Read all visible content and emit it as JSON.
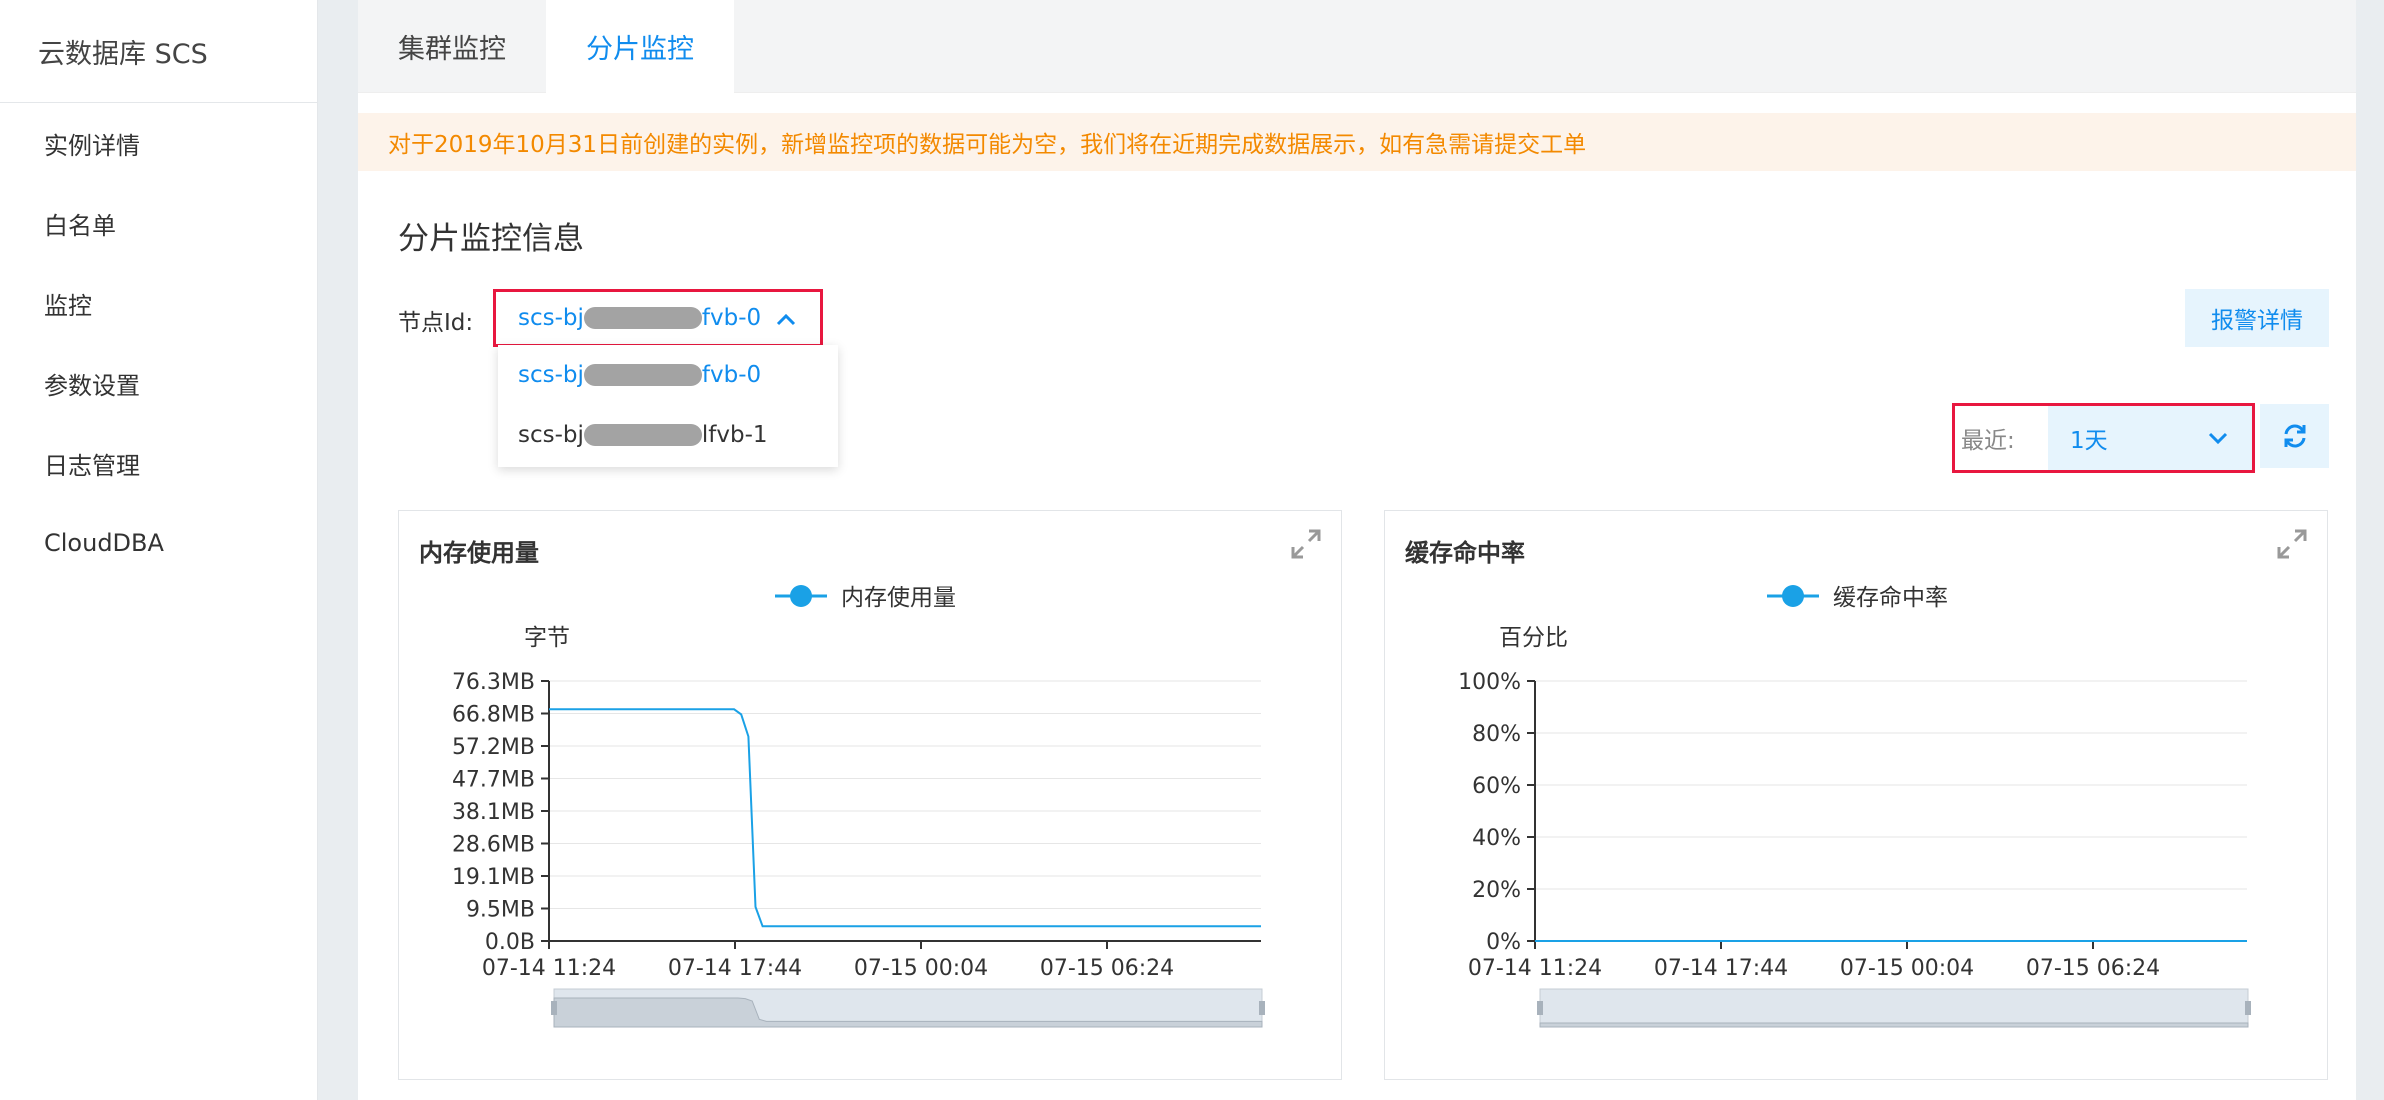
{
  "sidebar": {
    "product": "云数据库 SCS",
    "items": [
      "实例详情",
      "白名单",
      "监控",
      "参数设置",
      "日志管理",
      "CloudDBA"
    ]
  },
  "tabs": [
    {
      "label": "集群监控",
      "active": false
    },
    {
      "label": "分片监控",
      "active": true
    }
  ],
  "notice": "对于2019年10月31日前创建的实例，新增监控项的数据可能为空，我们将在近期完成数据展示，如有急需请提交工单",
  "section_title": "分片监控信息",
  "node": {
    "label": "节点Id:",
    "selected_prefix": "scs-bj",
    "selected_suffix": "fvb-0",
    "options": [
      {
        "prefix": "scs-bj",
        "suffix": "fvb-0",
        "selected": true
      },
      {
        "prefix": "scs-bj",
        "suffix": "lfvb-1",
        "selected": false
      }
    ]
  },
  "alarm_button": "报警详情",
  "recent": {
    "label": "最近:",
    "value": "1天"
  },
  "icons": {
    "refresh": "refresh-icon",
    "expand": "expand-icon",
    "chevron_up": "chevron-up-icon",
    "chevron_down": "chevron-down-icon"
  },
  "colors": {
    "accent": "#108cee",
    "series": "#1aa1e6",
    "notice_text": "#f38900",
    "highlight_border": "#e8173f"
  },
  "chart_data": [
    {
      "type": "line",
      "title": "内存使用量",
      "legend": "内存使用量",
      "ylabel": "字节",
      "y_ticks": [
        "0.0B",
        "9.5MB",
        "19.1MB",
        "28.6MB",
        "38.1MB",
        "47.7MB",
        "57.2MB",
        "66.8MB",
        "76.3MB"
      ],
      "x_ticks": [
        "07-14 11:24",
        "07-14 17:44",
        "07-15 00:04",
        "07-15 06:24"
      ],
      "ylim": [
        0,
        76.3
      ],
      "unit": "MB",
      "series": [
        {
          "name": "内存使用量",
          "x": [
            0,
            0.26,
            0.27,
            0.28,
            0.29,
            0.3,
            0.5,
            0.76,
            1.0
          ],
          "values": [
            68,
            68,
            66.5,
            60,
            10,
            4.3,
            4.3,
            4.3,
            4.3
          ]
        }
      ]
    },
    {
      "type": "line",
      "title": "缓存命中率",
      "legend": "缓存命中率",
      "ylabel": "百分比",
      "y_ticks": [
        "0%",
        "20%",
        "40%",
        "60%",
        "80%",
        "100%"
      ],
      "x_ticks": [
        "07-14 11:24",
        "07-14 17:44",
        "07-15 00:04",
        "07-15 06:24"
      ],
      "ylim": [
        0,
        100
      ],
      "unit": "%",
      "series": [
        {
          "name": "缓存命中率",
          "x": [
            0,
            1.0
          ],
          "values": [
            0,
            0
          ]
        }
      ]
    }
  ]
}
